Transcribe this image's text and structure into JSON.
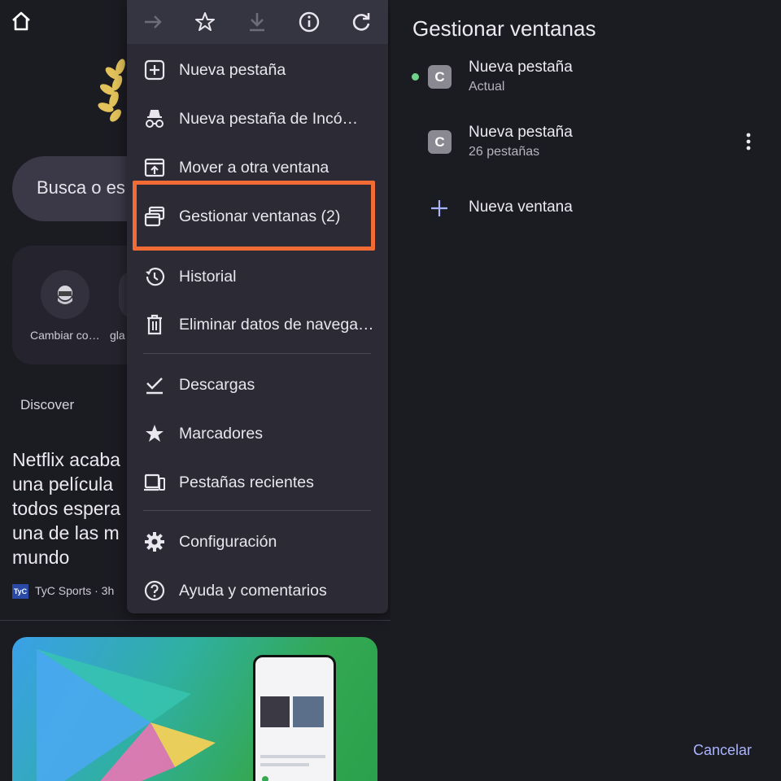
{
  "left": {
    "search_placeholder": "Busca o es",
    "shortcuts": [
      {
        "label": "Cambiar co…"
      },
      {
        "label": "gla"
      }
    ],
    "discover_label": "Discover",
    "article": {
      "title_lines": [
        "Netflix acaba",
        "una película",
        "todos espera",
        "una de las m",
        "mundo"
      ],
      "source": "TyC Sports · 3h",
      "source_logo": "TyC"
    }
  },
  "menu": {
    "toolbar": [
      {
        "icon": "forward-arrow-icon",
        "enabled": false
      },
      {
        "icon": "star-outline-icon",
        "enabled": true
      },
      {
        "icon": "download-icon",
        "enabled": false
      },
      {
        "icon": "info-icon",
        "enabled": true
      },
      {
        "icon": "reload-icon",
        "enabled": true
      }
    ],
    "items": [
      {
        "icon": "new-tab-icon",
        "label": "Nueva pestaña"
      },
      {
        "icon": "incognito-icon",
        "label": "Nueva pestaña de Incó…"
      },
      {
        "icon": "move-window-icon",
        "label": "Mover a otra ventana"
      },
      {
        "icon": "manage-windows-icon",
        "label": "Gestionar ventanas (2)",
        "highlighted": true
      },
      {
        "icon": "history-icon",
        "label": "Historial"
      },
      {
        "icon": "trash-icon",
        "label": "Eliminar datos de navega…"
      },
      {
        "icon": "downloads-check-icon",
        "label": "Descargas"
      },
      {
        "icon": "bookmarks-star-icon",
        "label": "Marcadores"
      },
      {
        "icon": "recent-tabs-icon",
        "label": "Pestañas recientes"
      },
      {
        "icon": "settings-gear-icon",
        "label": "Configuración"
      },
      {
        "icon": "help-icon",
        "label": "Ayuda y comentarios"
      }
    ],
    "highlight_color": "#f26b35"
  },
  "panel": {
    "title": "Gestionar ventanas",
    "windows": [
      {
        "avatar": "C",
        "title": "Nueva pestaña",
        "subtitle": "Actual",
        "current": true
      },
      {
        "avatar": "C",
        "title": "Nueva pestaña",
        "subtitle": "26 pestañas",
        "current": false
      }
    ],
    "new_window_label": "Nueva ventana",
    "cancel_label": "Cancelar",
    "current_dot_color": "#6fd18a",
    "accent_color": "#aab4ff"
  }
}
